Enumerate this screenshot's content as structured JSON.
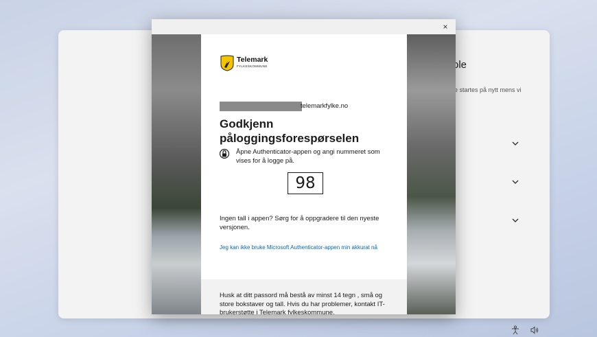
{
  "background": {
    "title_fragment": "ole",
    "subtitle_fragment": "je startes på nytt mens vi",
    "chevrons": [
      "chevron-down-icon",
      "chevron-down-icon",
      "chevron-down-icon"
    ]
  },
  "dialog": {
    "close_label": "×",
    "logo": {
      "name": "Telemark",
      "sub": "FYLKESKOMMUNE"
    },
    "email_domain": "telemarkfylke.no",
    "heading": "Godkjenn påloggingsforespørselen",
    "instruction": "Åpne Authenticator-appen og angi nummeret som vises for å logge på.",
    "number": "98",
    "no_number_text": "Ingen tall i appen? Sørg for å oppgradere til den nyeste versjonen.",
    "cant_use_link": "Jeg kan ikke bruke Microsoft Authenticator-appen min akkurat nå",
    "footer_text": "Husk at ditt passord må bestå av minst 14 tegn , små og store bokstaver og tall. Hvis du har problemer, kontakt IT-brukerstøtte i Telemark fylkeskommune."
  },
  "colors": {
    "link": "#0067b8",
    "logo_yellow": "#f5c400"
  },
  "taskbar": {
    "icons": [
      "accessibility-icon",
      "volume-icon"
    ]
  }
}
